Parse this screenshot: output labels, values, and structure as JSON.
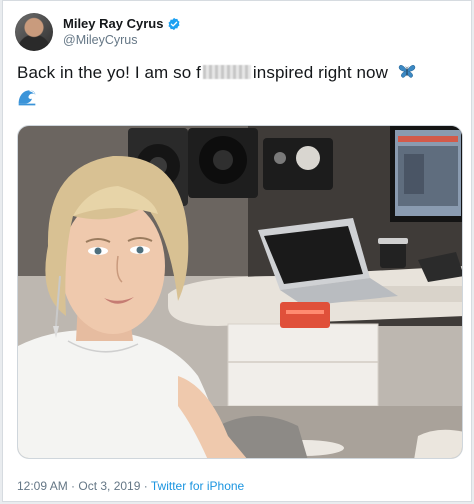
{
  "tweet": {
    "author": {
      "display_name": "Miley Ray Cyrus",
      "handle": "@MileyCyrus",
      "verified": true
    },
    "text_part1": "Back in the yo! I am so f",
    "text_censored": "***",
    "text_part2": "inspired right now",
    "emojis": [
      "butterfly-emoji",
      "wave-emoji"
    ],
    "timestamp": "12:09 AM · Oct 3, 2019",
    "separator": " · ",
    "source": "Twitter for iPhone"
  },
  "colors": {
    "text": "#14171a",
    "muted": "#657786",
    "link": "#1b95e0",
    "verified_blue": "#1da1f2",
    "border": "#d6dbe0"
  },
  "media": {
    "type": "photo",
    "subject": "woman with blonde bob hair in a music studio with speakers, laptop and monitor"
  }
}
